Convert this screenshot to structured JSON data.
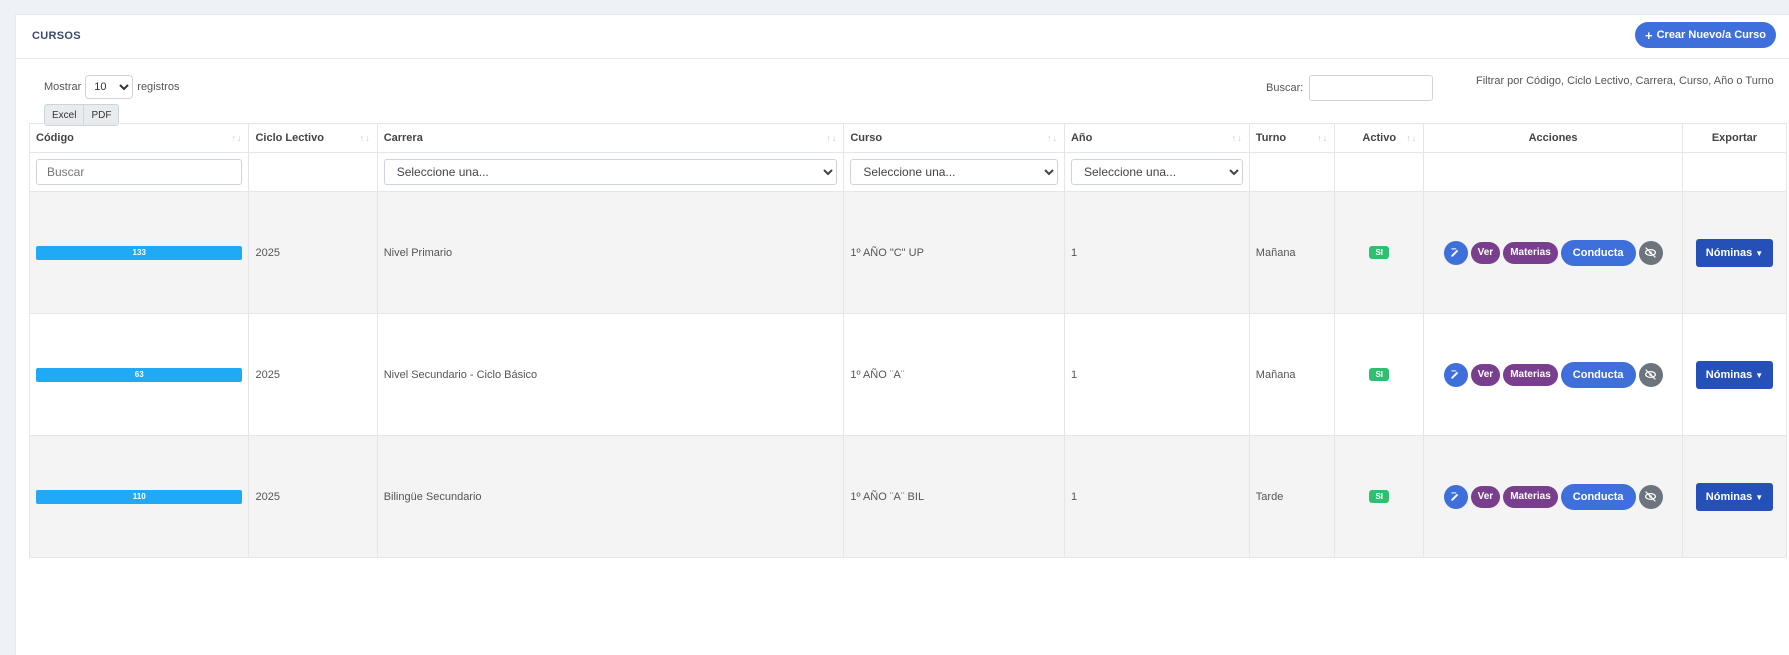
{
  "header": {
    "title": "CURSOS",
    "create_label": "Crear Nuevo/a Curso"
  },
  "controls": {
    "show_label": "Mostrar",
    "show_value": "10",
    "records_label": "registros",
    "excel_label": "Excel",
    "pdf_label": "PDF",
    "search_label": "Buscar:",
    "filter_hint": "Filtrar por Código, Ciclo Lectivo, Carrera, Curso, Año o Turno"
  },
  "columns": {
    "codigo": "Código",
    "ciclo": "Ciclo Lectivo",
    "carrera": "Carrera",
    "curso": "Curso",
    "anio": "Año",
    "turno": "Turno",
    "activo": "Activo",
    "acciones": "Acciones",
    "exportar": "Exportar"
  },
  "filters": {
    "codigo_placeholder": "Buscar",
    "carrera_placeholder": "Seleccione una...",
    "curso_placeholder": "Seleccione una...",
    "anio_placeholder": "Seleccione una..."
  },
  "rows": [
    {
      "codigo": "133",
      "ciclo": "2025",
      "carrera": "Nivel Primario",
      "curso": "1º AÑO \"C\" UP",
      "anio": "1",
      "turno": "Mañana",
      "activo": "SI"
    },
    {
      "codigo": "63",
      "ciclo": "2025",
      "carrera": "Nivel Secundario - Ciclo Básico",
      "curso": "1º AÑO ¨A¨",
      "anio": "1",
      "turno": "Mañana",
      "activo": "SI"
    },
    {
      "codigo": "110",
      "ciclo": "2025",
      "carrera": "Bilingüe Secundario",
      "curso": "1º AÑO ¨A¨ BIL",
      "anio": "1",
      "turno": "Tarde",
      "activo": "SI"
    }
  ],
  "actions": {
    "ver": "Ver",
    "materias": "Materias",
    "conducta": "Conducta",
    "nominas": "Nóminas"
  },
  "colors": {
    "primary": "#3e6fdb",
    "purple": "#7a3e8e",
    "code_bar": "#20a9f4",
    "active_badge": "#2fbf71",
    "nominas": "#2450b8"
  }
}
